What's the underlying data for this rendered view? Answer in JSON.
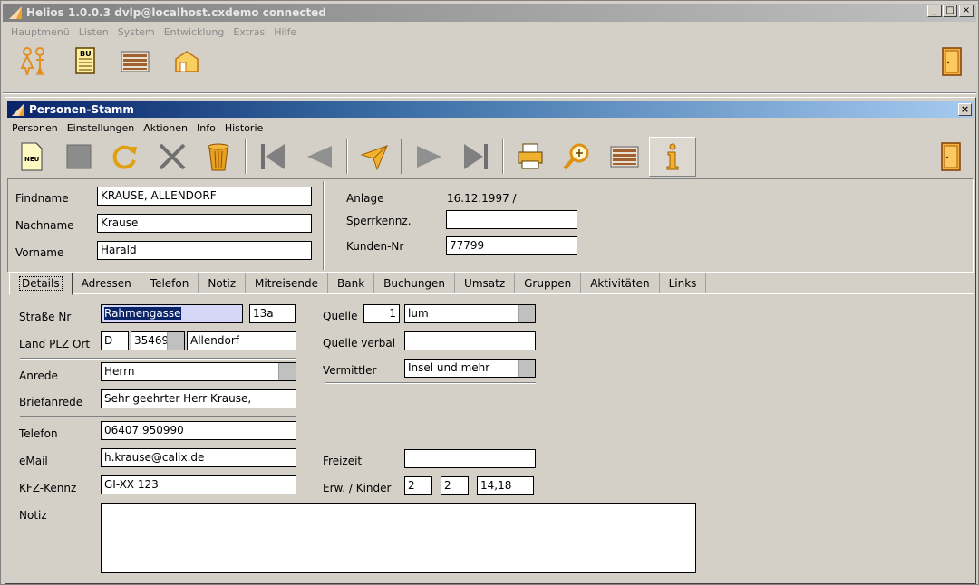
{
  "window": {
    "title": "Helios 1.0.0.3 dvlp@localhost.cxdemo connected",
    "menu": [
      "Hauptmenü",
      "Listen",
      "System",
      "Entwicklung",
      "Extras",
      "Hilfe"
    ],
    "buttons": {
      "minimize": "_",
      "maximize": "□",
      "close": "×"
    },
    "bu_icon_text": "BU"
  },
  "form": {
    "title": "Personen-Stamm",
    "close": "×",
    "menu": [
      "Personen",
      "Einstellungen",
      "Aktionen",
      "Info",
      "Historie"
    ],
    "neu_icon_text": "NEU"
  },
  "header": {
    "findname": {
      "label": "Findname",
      "value": "KRAUSE, ALLENDORF"
    },
    "nachname": {
      "label": "Nachname",
      "value": "Krause"
    },
    "vorname": {
      "label": "Vorname",
      "value": "Harald"
    },
    "anlage": {
      "label": "Anlage",
      "value": "16.12.1997 /"
    },
    "sperrkennz": {
      "label": "Sperrkennz.",
      "value": ""
    },
    "kunden_nr": {
      "label": "Kunden-Nr",
      "value": "77799"
    }
  },
  "tabs": [
    "Details",
    "Adressen",
    "Telefon",
    "Notiz",
    "Mitreisende",
    "Bank",
    "Buchungen",
    "Umsatz",
    "Gruppen",
    "Aktivitäten",
    "Links"
  ],
  "details": {
    "strasse": {
      "label": "Straße Nr",
      "value": "Rahmengasse",
      "nr": "13a"
    },
    "land_plz_ort": {
      "label": "Land PLZ Ort",
      "land": "D",
      "plz": "35469",
      "ort": "Allendorf"
    },
    "anrede": {
      "label": "Anrede",
      "value": "Herrn"
    },
    "briefanrede": {
      "label": "Briefanrede",
      "value": "Sehr geehrter Herr Krause,"
    },
    "telefon": {
      "label": "Telefon",
      "value": "06407 950990"
    },
    "email": {
      "label": "eMail",
      "value": "h.krause@calix.de"
    },
    "kfz": {
      "label": "KFZ-Kennz",
      "value": "GI-XX 123"
    },
    "notiz": {
      "label": "Notiz",
      "value": ""
    },
    "quelle": {
      "label": "Quelle",
      "code": "1",
      "value": "lum"
    },
    "quelle_verbal": {
      "label": "Quelle verbal",
      "value": ""
    },
    "vermittler": {
      "label": "Vermittler",
      "value": "Insel und mehr"
    },
    "freizeit": {
      "label": "Freizeit",
      "value": ""
    },
    "erw_kinder": {
      "label": "Erw. / Kinder",
      "erw": "2",
      "kinder": "2",
      "alter": "14,18"
    }
  }
}
